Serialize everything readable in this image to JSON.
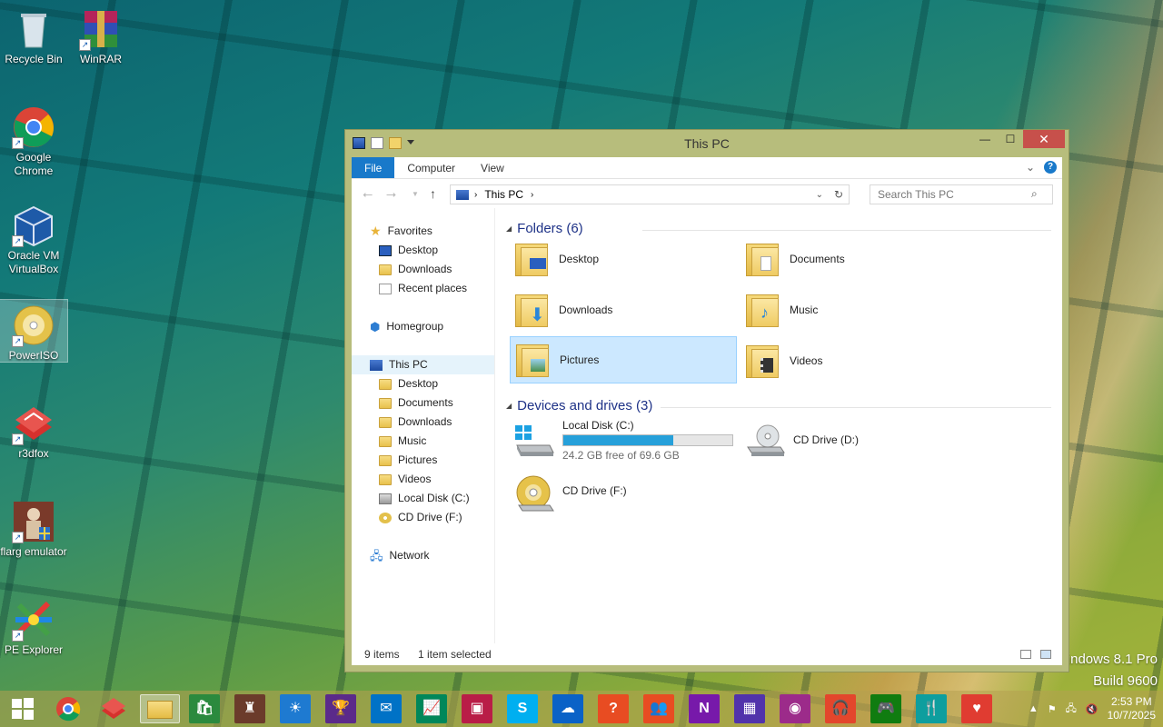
{
  "desktop": {
    "icons": [
      {
        "label": "Recycle Bin"
      },
      {
        "label": "WinRAR"
      },
      {
        "label": "Google Chrome"
      },
      {
        "label": "Oracle VM VirtualBox"
      },
      {
        "label": "PowerISO"
      },
      {
        "label": "r3dfox"
      },
      {
        "label": "flarg emulator"
      },
      {
        "label": "PE Explorer"
      }
    ],
    "watermark_line1": "indows 8.1 Pro",
    "watermark_line2": "Build 9600"
  },
  "window": {
    "title": "This PC",
    "close_glyph": "✕",
    "minimize_glyph": "—",
    "maximize_glyph": "☐",
    "ribbon_tabs": [
      "File",
      "Computer",
      "View"
    ],
    "help_glyph": "?",
    "address_path": "This PC",
    "search_placeholder": "Search This PC",
    "nav": {
      "favorites": "Favorites",
      "fav_items": [
        "Desktop",
        "Downloads",
        "Recent places"
      ],
      "homegroup": "Homegroup",
      "this_pc": "This PC",
      "pc_items": [
        "Desktop",
        "Documents",
        "Downloads",
        "Music",
        "Pictures",
        "Videos",
        "Local Disk (C:)",
        "CD Drive (F:)"
      ],
      "network": "Network"
    },
    "folders_header": "Folders (6)",
    "folders": [
      "Desktop",
      "Documents",
      "Downloads",
      "Music",
      "Pictures",
      "Videos"
    ],
    "drives_header": "Devices and drives (3)",
    "drives": [
      {
        "name": "Local Disk (C:)",
        "free": "24.2 GB free of 69.6 GB",
        "used_fraction": 0.65
      },
      {
        "name": "CD Drive (D:)"
      },
      {
        "name": "CD Drive (F:)"
      }
    ],
    "status_items": "9 items",
    "status_selected": "1 item selected"
  },
  "taskbar": {
    "time": "2:53 PM",
    "date": "10/7/2025",
    "colors": {
      "store": "#2b8a3e",
      "mail": "#0072c6",
      "finance": "#00875a",
      "video": "#b91d47",
      "skype": "#00aff0",
      "onedrive": "#0a62c7",
      "help": "#e84c22",
      "people": "#e84c22",
      "onenote": "#7719aa",
      "calendar": "#5133ab",
      "camera": "#9c2b8a",
      "music": "#e3462c",
      "games": "#107c10",
      "food": "#0e9e9e",
      "health": "#e03c31"
    }
  }
}
